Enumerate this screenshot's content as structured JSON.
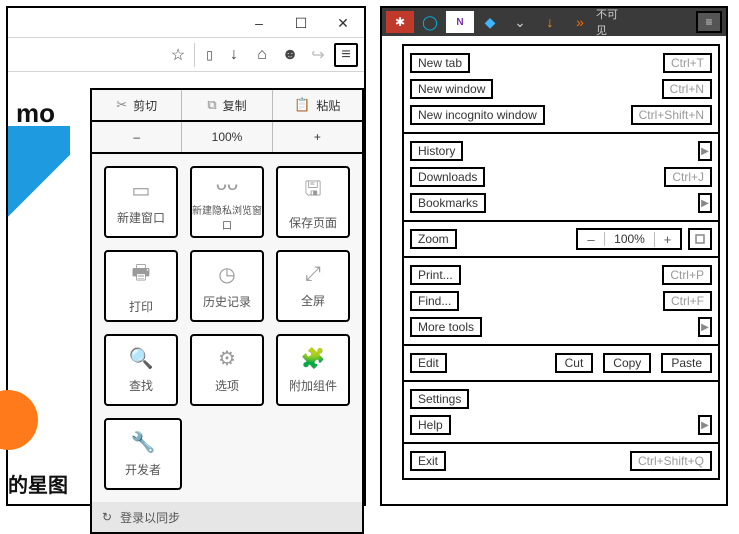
{
  "left": {
    "page": {
      "mo_prefix": "mo",
      "cn_text": "的星图"
    },
    "edit_row": {
      "cut": "剪切",
      "copy": "复制",
      "paste": "粘贴"
    },
    "zoom_row": {
      "minus": "–",
      "value": "100%",
      "plus": "+"
    },
    "tiles": {
      "new_window": "新建窗口",
      "new_private": "新建隐私浏览窗口",
      "save_page": "保存页面",
      "print": "打印",
      "history": "历史记录",
      "fullscreen": "全屏",
      "find": "查找",
      "options": "选项",
      "addons": "附加组件",
      "developer": "开发者"
    },
    "sync": "登录以同步"
  },
  "right": {
    "toolbar_text": "不可见",
    "section_new": {
      "new_tab": {
        "label": "New tab",
        "shortcut": "Ctrl+T"
      },
      "new_window": {
        "label": "New window",
        "shortcut": "Ctrl+N"
      },
      "new_incognito": {
        "label": "New incognito window",
        "shortcut": "Ctrl+Shift+N"
      }
    },
    "section_hist": {
      "history": {
        "label": "History"
      },
      "downloads": {
        "label": "Downloads",
        "shortcut": "Ctrl+J"
      },
      "bookmarks": {
        "label": "Bookmarks"
      }
    },
    "zoom": {
      "label": "Zoom",
      "minus": "–",
      "value": "100%",
      "plus": "+"
    },
    "section_tools": {
      "print": {
        "label": "Print...",
        "shortcut": "Ctrl+P"
      },
      "find": {
        "label": "Find...",
        "shortcut": "Ctrl+F"
      },
      "more_tools": {
        "label": "More tools"
      }
    },
    "edit": {
      "label": "Edit",
      "cut": "Cut",
      "copy": "Copy",
      "paste": "Paste"
    },
    "section_settings": {
      "settings": {
        "label": "Settings"
      },
      "help": {
        "label": "Help"
      }
    },
    "exit": {
      "label": "Exit",
      "shortcut": "Ctrl+Shift+Q"
    }
  }
}
